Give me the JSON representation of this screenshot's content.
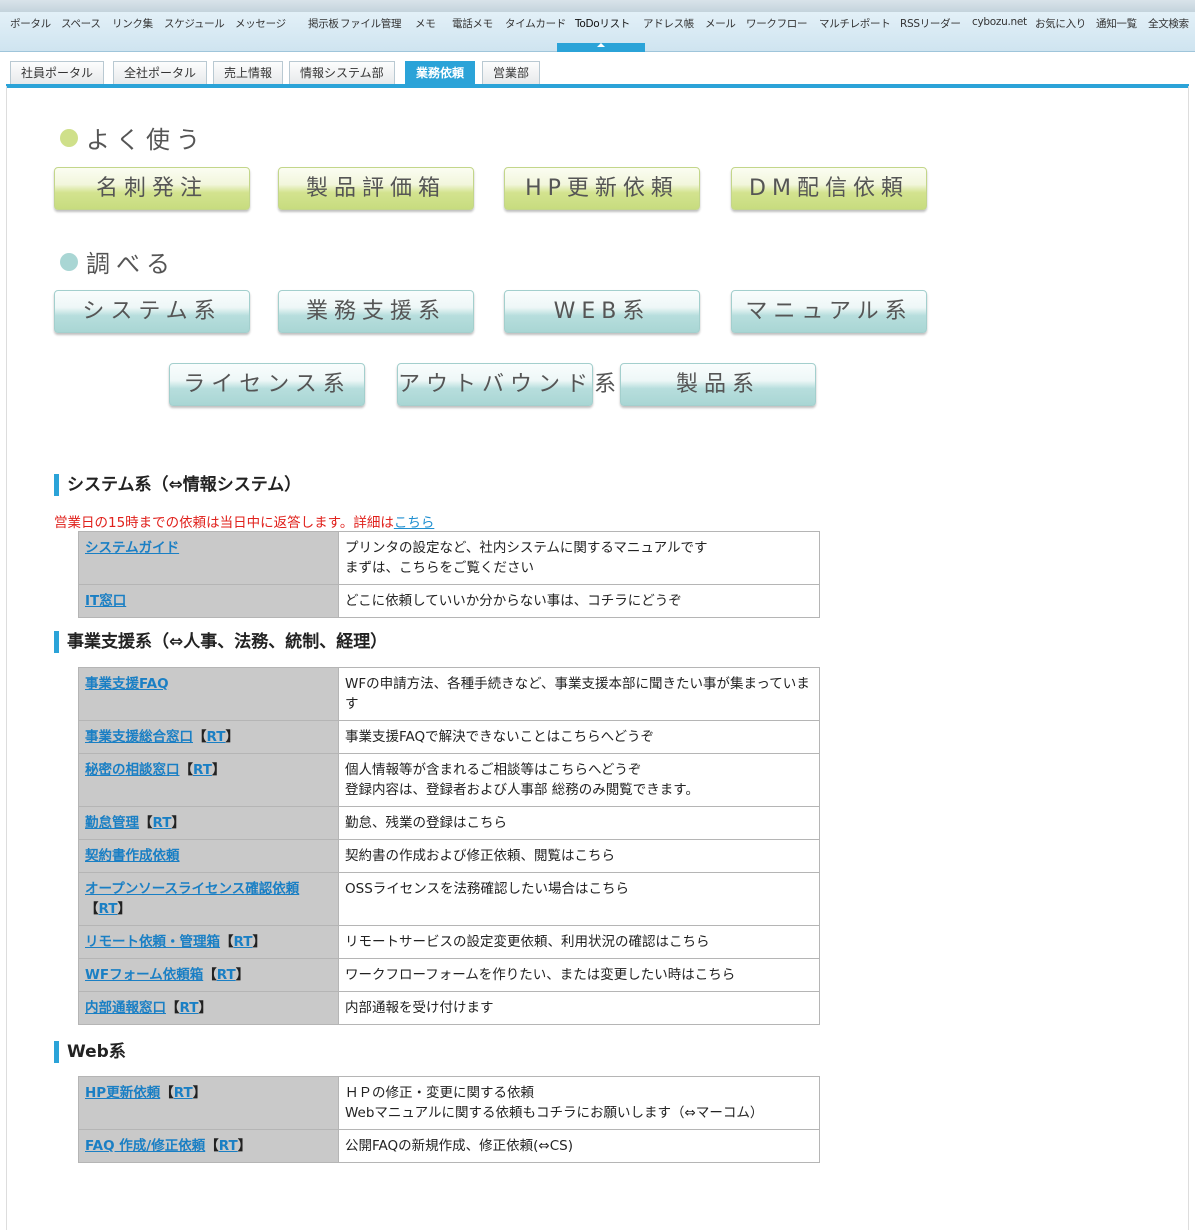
{
  "appnav": {
    "items": [
      "ポータル",
      "スペース",
      "リンク集",
      "スケジュール",
      "メッセージ",
      "掲示板",
      "ファイル管理",
      "メモ",
      "電話メモ",
      "タイムカード",
      "ToDoリスト",
      "アドレス帳",
      "メール",
      "ワークフロー",
      "マルチレポート",
      "RSSリーダー",
      "cybozu.net",
      "お気に入り",
      "通知一覧",
      "全文検索"
    ],
    "active": "ToDoリスト"
  },
  "tabs": {
    "items": [
      "社員ポータル",
      "全社ポータル",
      "売上情報",
      "情報システム部",
      "業務依頼",
      "営業部"
    ],
    "active": "業務依頼"
  },
  "frequent": {
    "title": "よく使う",
    "buttons": [
      "名刺発注",
      "製品評価箱",
      "HP更新依頼",
      "DM配信依頼"
    ]
  },
  "lookup": {
    "title": "調べる",
    "buttons_row1": [
      "システム系",
      "業務支援系",
      "WEB系",
      "マニュアル系"
    ],
    "buttons_row2": [
      "ライセンス系",
      "アウトバウンド系",
      "製品系"
    ]
  },
  "colors": {
    "accent": "#2ba3d8",
    "green_dot": "#cfe08a",
    "teal_dot": "#a9d6d4",
    "notice": "#e0201b"
  },
  "system": {
    "title": "システム系（⇔情報システム）",
    "notice": "営業日の15時までの依頼は当日中に返答します。詳細は",
    "notice_link": "こちら",
    "rows": [
      {
        "key": "システムガイド",
        "rt": "",
        "desc": "プリンタの設定など、社内システムに関するマニュアルです\nまずは、こちらをご覧ください"
      },
      {
        "key": "IT窓口",
        "rt": "",
        "desc": "どこに依頼していいか分からない事は、コチラにどうぞ"
      }
    ]
  },
  "business": {
    "title": "事業支援系（⇔人事、法務、統制、経理）",
    "rows": [
      {
        "key": "事業支援FAQ",
        "rt": "",
        "desc": "WFの申請方法、各種手続きなど、事業支援本部に聞きたい事が集まっています"
      },
      {
        "key": "事業支援総合窓口",
        "rt": "RT",
        "desc": "事業支援FAQで解決できないことはこちらへどうぞ"
      },
      {
        "key": "秘密の相談窓口",
        "rt": "RT",
        "desc": "個人情報等が含まれるご相談等はこちらへどうぞ\n登録内容は、登録者および人事部 総務のみ閲覧できます。"
      },
      {
        "key": "勤怠管理",
        "rt": "RT",
        "desc": "勤怠、残業の登録はこちら"
      },
      {
        "key": "契約書作成依頼",
        "rt": "",
        "desc": "契約書の作成および修正依頼、閲覧はこちら"
      },
      {
        "key": "オープンソースライセンス確認依頼",
        "rt": "RT",
        "desc": "OSSライセンスを法務確認したい場合はこちら\n "
      },
      {
        "key": "リモート依頼・管理箱",
        "rt": "RT",
        "desc": "リモートサービスの設定変更依頼、利用状況の確認はこちら"
      },
      {
        "key": "WFフォーム依頼箱",
        "rt": "RT",
        "desc": "ワークフローフォームを作りたい、または変更したい時はこちら"
      },
      {
        "key": "内部通報窓口",
        "rt": "RT",
        "desc": "内部通報を受け付けます"
      }
    ]
  },
  "web": {
    "title": "Web系",
    "rows": [
      {
        "key": "HP更新依頼",
        "rt": "RT",
        "desc": "ＨＰの修正・変更に関する依頼\nWebマニュアルに関する依頼もコチラにお願いします（⇔マーコム）"
      },
      {
        "key": "FAQ 作成/修正依頼",
        "rt": "RT",
        "desc": "公開FAQの新規作成、修正依頼(⇔CS)"
      }
    ]
  }
}
